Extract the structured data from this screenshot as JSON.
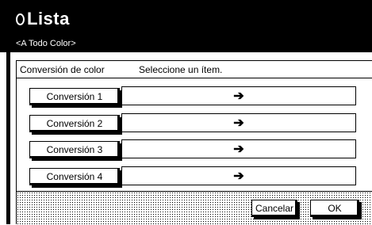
{
  "header": {
    "status_title": "Lista",
    "subtitle": "<A Todo Color>"
  },
  "panel": {
    "label": "Conversión de color",
    "instruction": "Seleccione un ítem."
  },
  "rows": [
    {
      "button": "Conversión 1",
      "value": "➔"
    },
    {
      "button": "Conversión 2",
      "value": "➔"
    },
    {
      "button": "Conversión 3",
      "value": "➔"
    },
    {
      "button": "Conversión 4",
      "value": "➔"
    }
  ],
  "footer": {
    "cancel_label": "Cancelar",
    "ok_label": "OK"
  },
  "colors": {
    "background": "#000000",
    "panel": "#ffffff",
    "text": "#000000"
  }
}
